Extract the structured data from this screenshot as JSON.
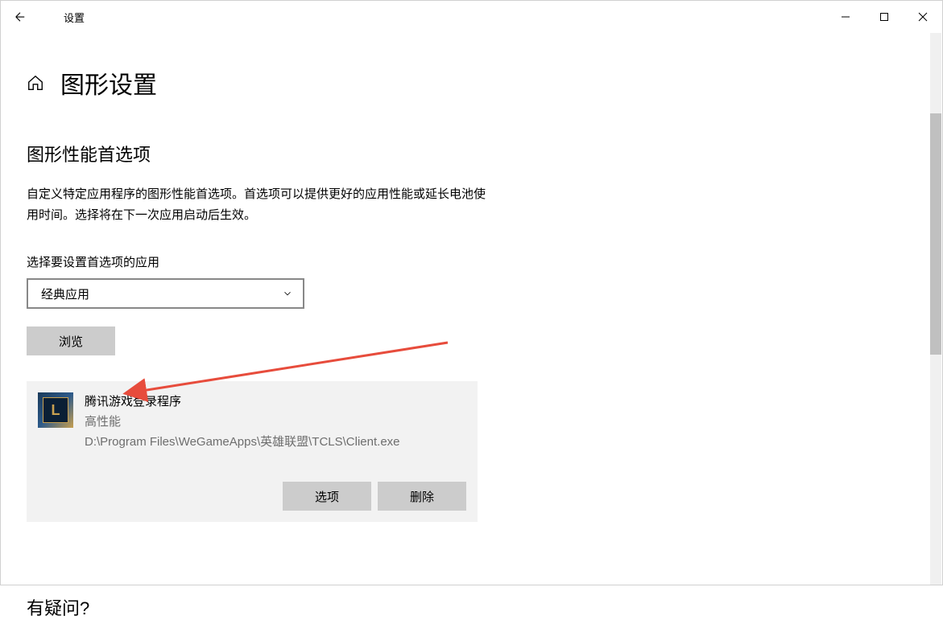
{
  "window": {
    "title": "设置"
  },
  "page": {
    "title": "图形设置"
  },
  "section": {
    "heading": "图形性能首选项",
    "description": "自定义特定应用程序的图形性能首选项。首选项可以提供更好的应用性能或延长电池使用时间。选择将在下一次应用启动后生效。",
    "select_label": "选择要设置首选项的应用",
    "dropdown_value": "经典应用",
    "browse_label": "浏览"
  },
  "app": {
    "name": "腾讯游戏登录程序",
    "performance": "高性能",
    "path": "D:\\Program Files\\WeGameApps\\英雄联盟\\TCLS\\Client.exe",
    "options_label": "选项",
    "delete_label": "删除"
  },
  "faq": {
    "heading": "有疑问?"
  }
}
